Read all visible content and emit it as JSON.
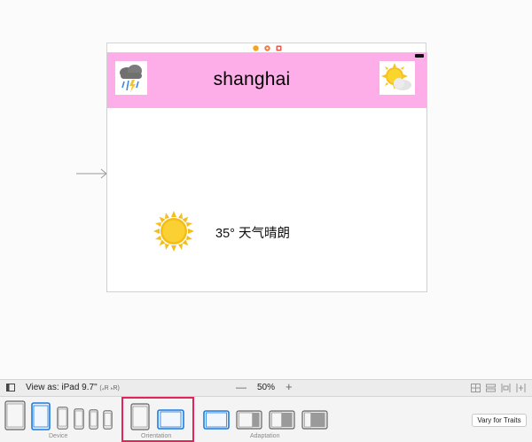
{
  "scene": {
    "city": "shanghai",
    "weather_text": "35° 天气晴朗",
    "header_color": "#fdaee9"
  },
  "toolbar": {
    "view_as_prefix": "View as: iPad 9.7\"",
    "size_class_w": "(₄R ₕR)",
    "zoom_level": "50%",
    "zoom_out_glyph": "—",
    "zoom_in_glyph": "+"
  },
  "traits": {
    "device_label": "Device",
    "orientation_label": "Orientation",
    "adaptation_label": "Adaptation",
    "vary_button": "Vary for Traits",
    "highlight_color": "#e2245a",
    "accent_color": "#1d7be0"
  },
  "icons": [
    "storm-cloud-icon",
    "sun-behind-cloud-icon",
    "sun-icon",
    "entry-arrow-icon",
    "battery-icon"
  ]
}
